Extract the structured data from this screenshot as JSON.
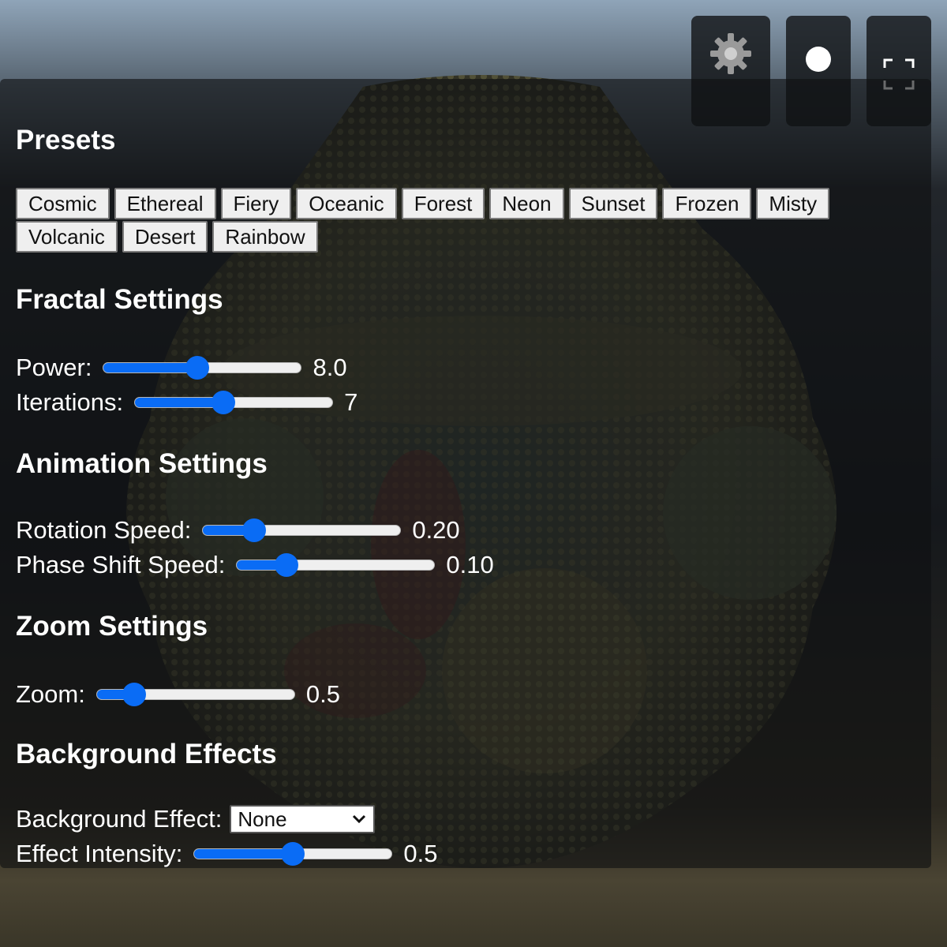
{
  "presets": {
    "title": "Presets",
    "buttons": [
      "Cosmic",
      "Ethereal",
      "Fiery",
      "Oceanic",
      "Forest",
      "Neon",
      "Sunset",
      "Frozen",
      "Misty",
      "Volcanic",
      "Desert",
      "Rainbow"
    ]
  },
  "fractal": {
    "title": "Fractal Settings",
    "power": {
      "label": "Power:",
      "value": "8.0",
      "level": 0.47
    },
    "iterations": {
      "label": "Iterations:",
      "value": "7",
      "level": 0.44
    }
  },
  "animation": {
    "title": "Animation Settings",
    "rotation": {
      "label": "Rotation Speed:",
      "value": "0.20",
      "level": 0.23
    },
    "phase": {
      "label": "Phase Shift Speed:",
      "value": "0.10",
      "level": 0.22
    }
  },
  "zoom": {
    "title": "Zoom Settings",
    "zoom": {
      "label": "Zoom:",
      "value": "0.5",
      "level": 0.15
    }
  },
  "background": {
    "title": "Background Effects",
    "effect": {
      "label": "Background Effect:",
      "selected": "None"
    },
    "intensity": {
      "label": "Effect Intensity:",
      "value": "0.5",
      "level": 0.5
    }
  },
  "toolbar": {
    "icons": [
      "gear-icon",
      "record-icon",
      "fullscreen-icon"
    ]
  },
  "colors": {
    "accent": "#0a6cf5",
    "panel": "#0e1012"
  }
}
